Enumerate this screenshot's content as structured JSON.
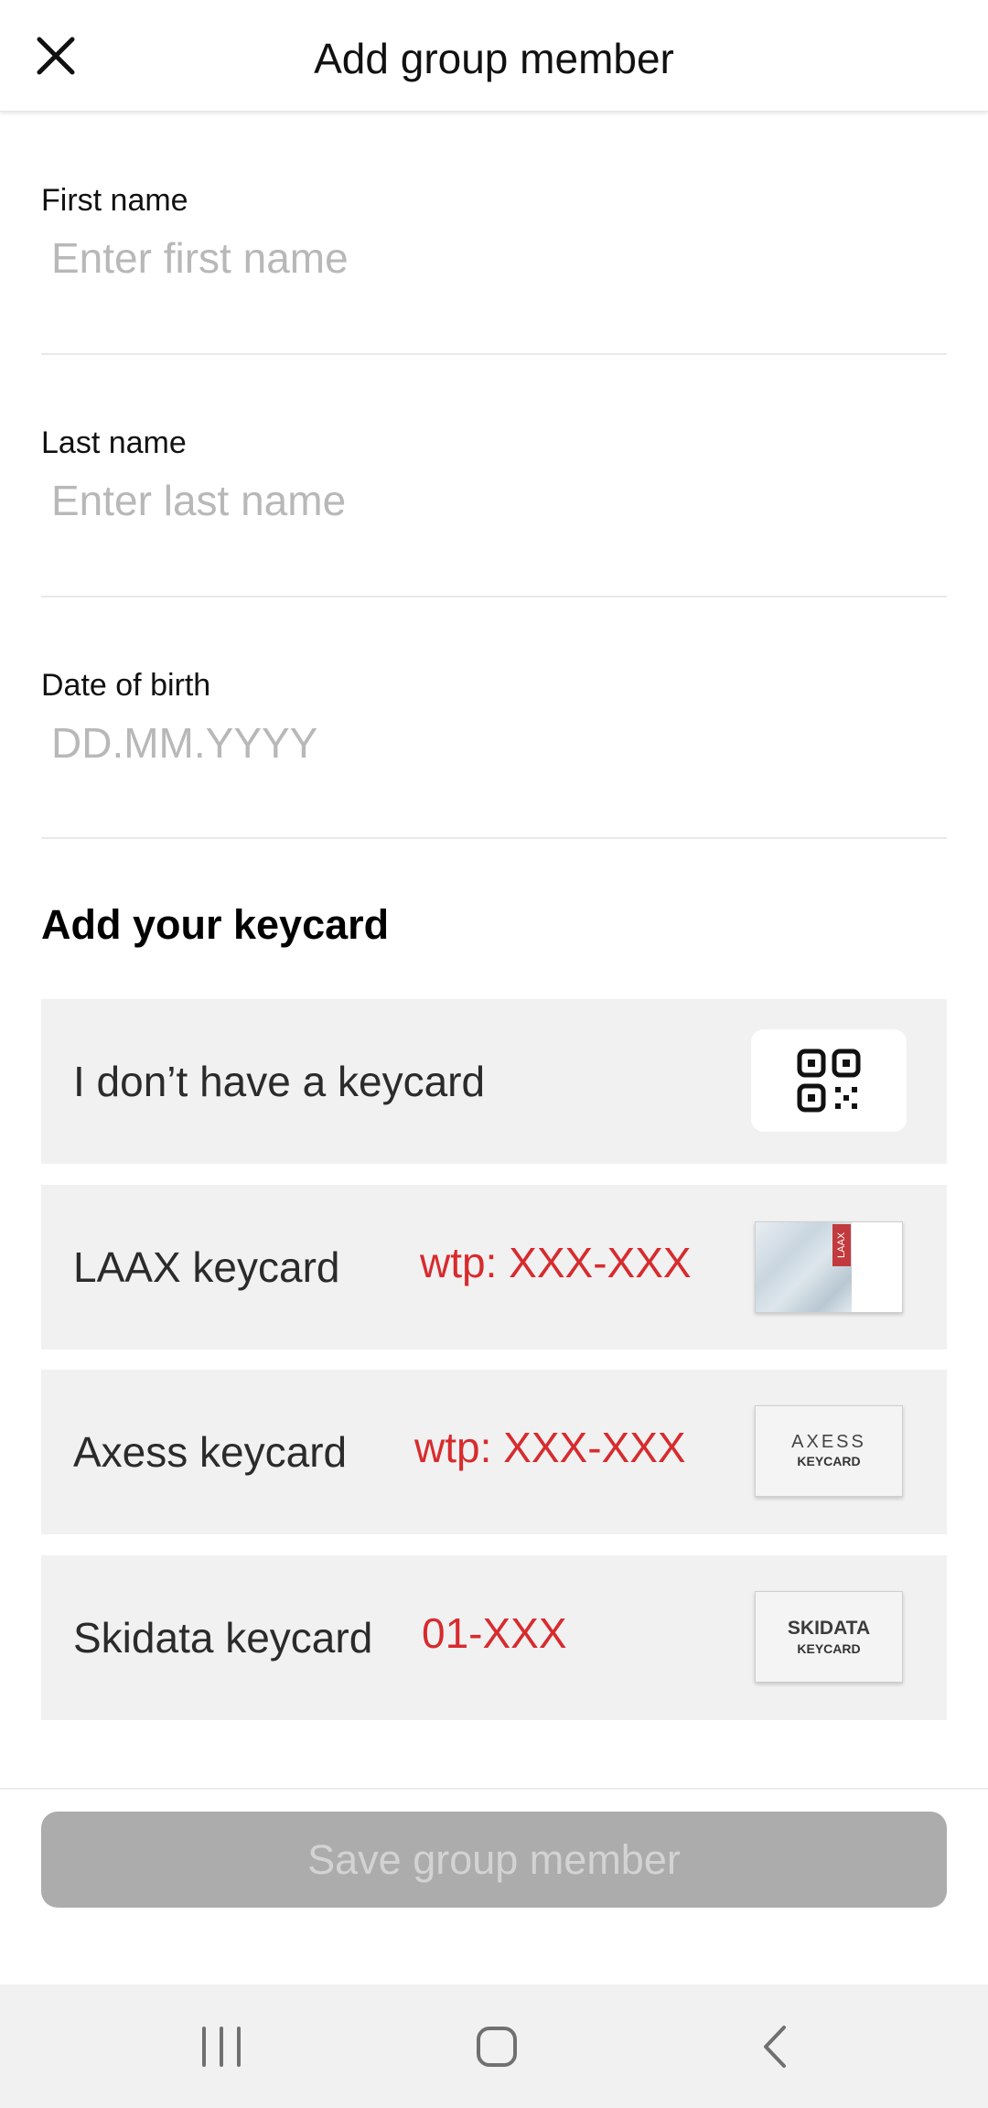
{
  "header": {
    "title": "Add group member",
    "close_icon": "close-icon"
  },
  "form": {
    "first_name": {
      "label": "First name",
      "placeholder": "Enter first name",
      "value": ""
    },
    "last_name": {
      "label": "Last name",
      "placeholder": "Enter last name",
      "value": ""
    },
    "date_of_birth": {
      "label": "Date of birth",
      "placeholder": "DD.MM.YYYY",
      "value": ""
    }
  },
  "keycard_section": {
    "title": "Add your keycard",
    "options": [
      {
        "label": "I don’t have a keycard",
        "format": "",
        "icon": "qr-code-icon"
      },
      {
        "label": "LAAX keycard",
        "format": "wtp: XXX-XXX",
        "image": "laax-keycard-image",
        "badge": "LAAX"
      },
      {
        "label": "Axess keycard",
        "format": "wtp: XXX-XXX",
        "image": "axess-keycard-image",
        "brand": "AXESS",
        "brand_sub": "KEYCARD"
      },
      {
        "label": "Skidata keycard",
        "format": "01-XXX",
        "image": "skidata-keycard-image",
        "brand": "SKIDATA",
        "brand_sub": "KEYCARD"
      }
    ]
  },
  "footer": {
    "save_label": "Save group member",
    "save_enabled": false
  },
  "navbar": {
    "recent_icon": "recent-apps-icon",
    "home_icon": "home-icon",
    "back_icon": "back-icon"
  },
  "colors": {
    "format_text": "#d72b2e",
    "row_background": "#f1f1f1",
    "disabled_button": "#acacac",
    "placeholder": "#b8b8b8"
  }
}
